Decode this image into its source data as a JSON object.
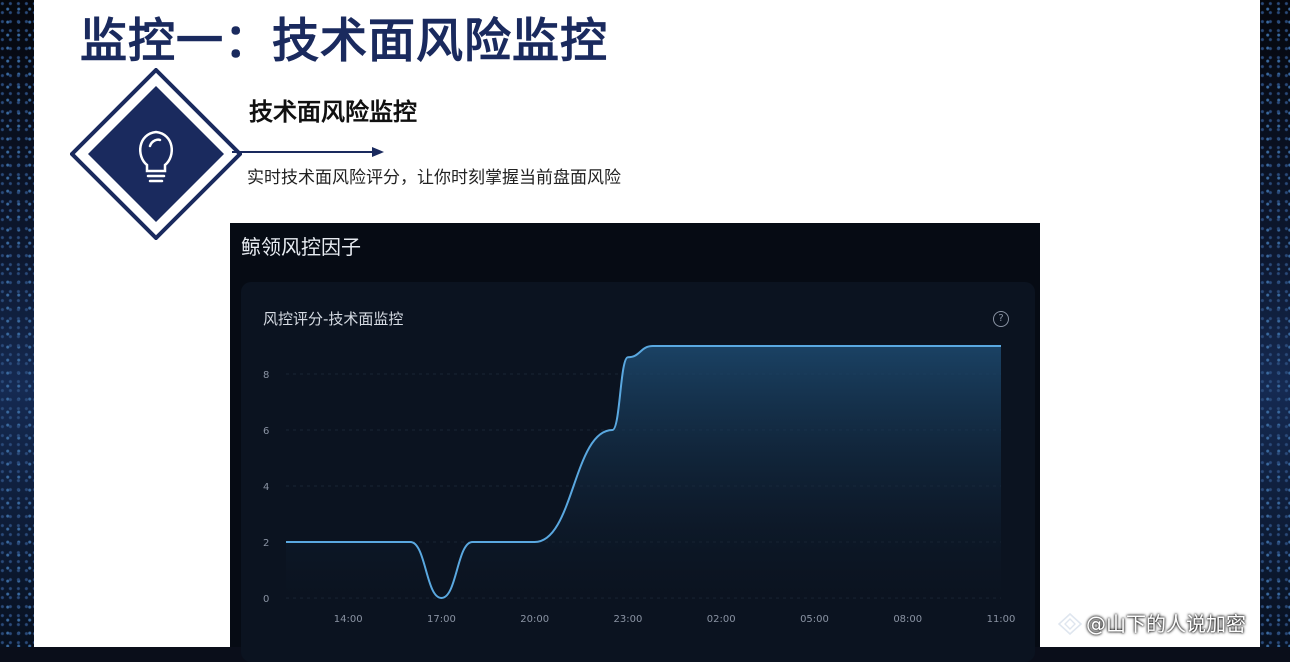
{
  "slide": {
    "title": "监控一：技术面风险监控",
    "section_title": "技术面风险监控",
    "section_desc": "实时技术面风险评分，让你时刻掌握当前盘面风险",
    "icon": "lightbulb-icon"
  },
  "dashboard": {
    "title": "鲸领风控因子",
    "card_title": "风控评分-技术面监控",
    "help_glyph": "?"
  },
  "watermark": {
    "text": "@山下的人说加密",
    "icon": "diamond-logo-icon"
  },
  "colors": {
    "title_navy": "#1a2a5e",
    "dashboard_bg": "#060b14",
    "card_bg": "#0b1320",
    "line": "#5aa8e0",
    "area_top": "#1d4a70",
    "tick_text": "#8a93a3"
  },
  "chart_data": {
    "type": "area",
    "title": "风控评分-技术面监控",
    "xlabel": "",
    "ylabel": "",
    "x_ticks": [
      "14:00",
      "17:00",
      "20:00",
      "23:00",
      "02:00",
      "05:00",
      "08:00",
      "11:00"
    ],
    "y_ticks": [
      "0",
      "2",
      "4",
      "6",
      "8"
    ],
    "ylim": [
      0,
      9.5
    ],
    "grid": true,
    "series": [
      {
        "values": [
          {
            "t": 12.0,
            "y": 2
          },
          {
            "t": 16.0,
            "y": 2
          },
          {
            "t": 17.0,
            "y": 0
          },
          {
            "t": 18.0,
            "y": 2
          },
          {
            "t": 20.0,
            "y": 2
          },
          {
            "t": 22.5,
            "y": 6
          },
          {
            "t": 23.0,
            "y": 8.6
          },
          {
            "t": 23.8,
            "y": 9
          },
          {
            "t": 35.0,
            "y": 9
          }
        ]
      }
    ]
  }
}
